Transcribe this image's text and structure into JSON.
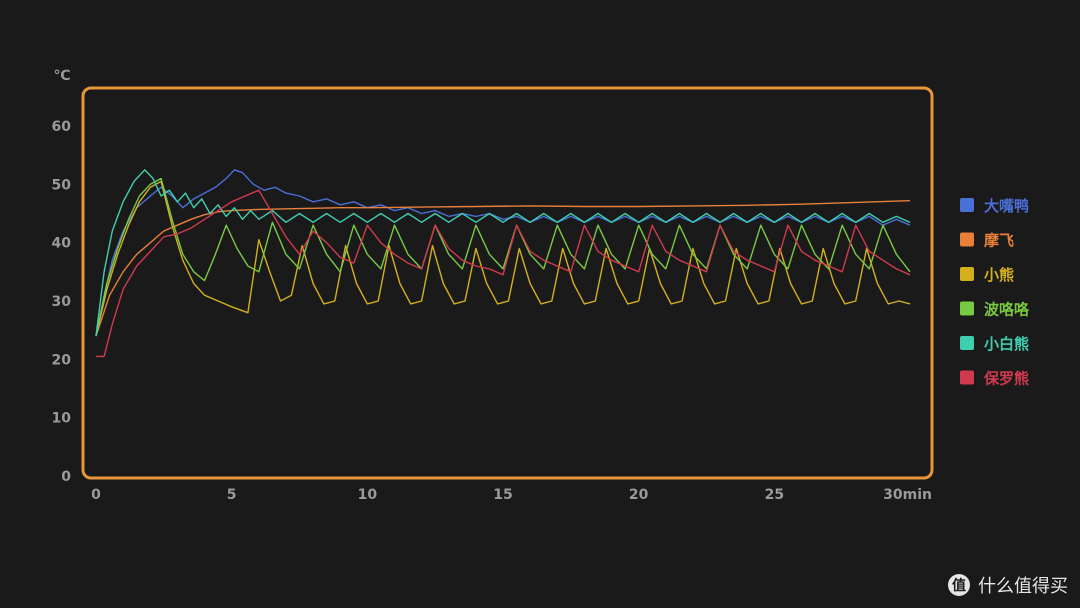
{
  "chart_data": {
    "type": "line",
    "ylabel": "℃",
    "xlim": [
      0,
      30
    ],
    "ylim": [
      0,
      60
    ],
    "x_ticks": [
      {
        "value": 0,
        "label": "0"
      },
      {
        "value": 5,
        "label": "5"
      },
      {
        "value": 10,
        "label": "10"
      },
      {
        "value": 15,
        "label": "15"
      },
      {
        "value": 20,
        "label": "20"
      },
      {
        "value": 25,
        "label": "25"
      },
      {
        "value": 30,
        "label": "30min"
      }
    ],
    "y_ticks": [
      0,
      10,
      20,
      30,
      40,
      50,
      60
    ],
    "grid": false,
    "legend_position": "right",
    "frame_color": "#e8963a",
    "series": [
      {
        "name": "大嘴鸭",
        "color": "#4a6fd6",
        "x": [
          0,
          0.3,
          0.6,
          1,
          1.5,
          2,
          2.4,
          2.8,
          3.2,
          3.6,
          4,
          4.4,
          4.8,
          5.1,
          5.4,
          5.8,
          6.2,
          6.6,
          7,
          7.5,
          8,
          8.5,
          9,
          9.5,
          10,
          10.5,
          11,
          11.5,
          12,
          12.5,
          13,
          13.5,
          14,
          14.5,
          15,
          15.5,
          16,
          16.5,
          17,
          17.5,
          18,
          18.5,
          19,
          19.5,
          20,
          20.5,
          21,
          21.5,
          22,
          22.5,
          23,
          23.5,
          24,
          24.5,
          25,
          25.5,
          26,
          26.5,
          27,
          27.5,
          28,
          28.5,
          29,
          29.5,
          30
        ],
        "values": [
          24,
          31,
          37,
          42,
          46,
          48,
          49.5,
          48,
          46,
          47.5,
          48.5,
          49.5,
          51,
          52.5,
          52,
          50,
          49,
          49.5,
          48.5,
          48,
          47,
          47.5,
          46.5,
          47,
          46,
          46.5,
          45.5,
          46,
          45,
          45.5,
          44.5,
          45,
          44.5,
          45,
          44,
          44.5,
          43.5,
          44.5,
          43.5,
          44.5,
          43.5,
          44.5,
          43.5,
          44.5,
          43.5,
          44.5,
          43.5,
          44.5,
          43.5,
          44.5,
          43.5,
          44.5,
          43.5,
          44.5,
          43.5,
          44.5,
          43.5,
          44.5,
          43.5,
          44.5,
          43.5,
          44.5,
          43,
          44,
          43
        ]
      },
      {
        "name": "摩飞",
        "color": "#e8803a",
        "x": [
          0,
          0.5,
          1,
          1.5,
          2,
          2.5,
          3,
          3.5,
          4,
          4.5,
          5,
          6,
          7,
          8,
          9,
          10,
          12,
          14,
          16,
          18,
          20,
          22,
          24,
          26,
          28,
          30
        ],
        "values": [
          24,
          31,
          35,
          38,
          40,
          42,
          43,
          44,
          44.8,
          45.3,
          45.5,
          45.7,
          45.8,
          45.9,
          46,
          46,
          46.1,
          46.2,
          46.3,
          46.2,
          46.2,
          46.3,
          46.4,
          46.6,
          46.9,
          47.2
        ]
      },
      {
        "name": "小熊",
        "color": "#d4b01e",
        "x": [
          0,
          0.4,
          0.8,
          1.2,
          1.6,
          2,
          2.4,
          2.8,
          3.2,
          3.6,
          4,
          4.5,
          5,
          5.6,
          6,
          6.4,
          6.8,
          7.2,
          7.6,
          8,
          8.4,
          8.8,
          9.2,
          9.6,
          10,
          10.4,
          10.8,
          11.2,
          11.6,
          12,
          12.4,
          12.8,
          13.2,
          13.6,
          14,
          14.4,
          14.8,
          15.2,
          15.6,
          16,
          16.4,
          16.8,
          17.2,
          17.6,
          18,
          18.4,
          18.8,
          19.2,
          19.6,
          20,
          20.4,
          20.8,
          21.2,
          21.6,
          22,
          22.4,
          22.8,
          23.2,
          23.6,
          24,
          24.4,
          24.8,
          25.2,
          25.6,
          26,
          26.4,
          26.8,
          27.2,
          27.6,
          28,
          28.4,
          28.8,
          29.2,
          29.6,
          30
        ],
        "values": [
          24,
          32,
          38,
          43,
          47,
          49.5,
          50.5,
          43,
          37,
          33,
          31,
          30,
          29,
          28,
          40.5,
          35,
          30,
          31,
          39.5,
          33,
          29.5,
          30,
          39.5,
          33,
          29.5,
          30,
          39.5,
          33,
          29.5,
          30,
          39.5,
          33,
          29.5,
          30,
          39,
          33,
          29.5,
          30,
          39,
          33,
          29.5,
          30,
          39,
          33,
          29.5,
          30,
          39,
          33,
          29.5,
          30,
          39,
          33,
          29.5,
          30,
          39,
          33,
          29.5,
          30,
          39,
          33,
          29.5,
          30,
          39,
          33,
          29.5,
          30,
          39,
          33,
          29.5,
          30,
          39,
          33,
          29.5,
          30,
          29.5
        ]
      },
      {
        "name": "波咯咯",
        "color": "#7ac943",
        "x": [
          0,
          0.4,
          0.8,
          1.2,
          1.6,
          2,
          2.4,
          2.8,
          3.2,
          3.6,
          4,
          4.4,
          4.8,
          5.2,
          5.6,
          6,
          6.5,
          7,
          7.5,
          8,
          8.5,
          9,
          9.5,
          10,
          10.5,
          11,
          11.5,
          12,
          12.5,
          13,
          13.5,
          14,
          14.5,
          15,
          15.5,
          16,
          16.5,
          17,
          17.5,
          18,
          18.5,
          19,
          19.5,
          20,
          20.5,
          21,
          21.5,
          22,
          22.5,
          23,
          23.5,
          24,
          24.5,
          25,
          25.5,
          26,
          26.5,
          27,
          27.5,
          28,
          28.5,
          29,
          29.5,
          30
        ],
        "values": [
          24,
          33,
          39,
          44,
          48,
          50,
          51,
          44,
          38,
          35,
          33.5,
          38,
          43,
          39,
          36,
          35,
          43.5,
          38,
          35.5,
          43,
          38,
          35,
          43,
          38,
          35.5,
          43,
          38,
          35.5,
          43,
          38,
          35.5,
          43,
          38,
          35.5,
          43,
          38,
          35.5,
          43,
          38,
          35.5,
          43,
          38,
          35.5,
          43,
          38,
          35.5,
          43,
          38,
          35.5,
          43,
          38,
          35.5,
          43,
          38,
          35.5,
          43,
          38,
          35.5,
          43,
          38,
          35.5,
          43,
          38,
          35
        ]
      },
      {
        "name": "小白熊",
        "color": "#3ecfb0",
        "x": [
          0,
          0.3,
          0.6,
          1,
          1.4,
          1.8,
          2.1,
          2.4,
          2.7,
          3,
          3.3,
          3.6,
          3.9,
          4.2,
          4.5,
          4.8,
          5.1,
          5.4,
          5.7,
          6,
          6.5,
          7,
          7.5,
          8,
          8.5,
          9,
          9.5,
          10,
          10.5,
          11,
          11.5,
          12,
          12.5,
          13,
          13.5,
          14,
          14.5,
          15,
          15.5,
          16,
          16.5,
          17,
          17.5,
          18,
          18.5,
          19,
          19.5,
          20,
          20.5,
          21,
          21.5,
          22,
          22.5,
          23,
          23.5,
          24,
          24.5,
          25,
          25.5,
          26,
          26.5,
          27,
          27.5,
          28,
          28.5,
          29,
          29.5,
          30
        ],
        "values": [
          24,
          35,
          42,
          47,
          50.5,
          52.5,
          51,
          48,
          49,
          47,
          48.5,
          46,
          47.5,
          45,
          46.5,
          44.5,
          46,
          44,
          45.5,
          44,
          45.5,
          43.5,
          45,
          43.5,
          45,
          43.5,
          45,
          43.5,
          45,
          43.5,
          45,
          43.5,
          45,
          43.5,
          45,
          43.5,
          45,
          43.5,
          45,
          43.5,
          45,
          43.5,
          45,
          43.5,
          45,
          43.5,
          45,
          43.5,
          45,
          43.5,
          45,
          43.5,
          45,
          43.5,
          45,
          43.5,
          45,
          43.5,
          45,
          43.5,
          45,
          43.5,
          45,
          43.5,
          45,
          43.5,
          44.5,
          43.5
        ]
      },
      {
        "name": "保罗熊",
        "color": "#d03a4e",
        "x": [
          0,
          0.3,
          0.6,
          1,
          1.5,
          2,
          2.5,
          3,
          3.5,
          4,
          4.5,
          5,
          5.5,
          6,
          6.5,
          7,
          7.5,
          8,
          8.5,
          9,
          9.5,
          10,
          10.5,
          11,
          11.5,
          12,
          12.5,
          13,
          13.5,
          14,
          14.5,
          15,
          15.5,
          16,
          16.5,
          17,
          17.5,
          18,
          18.5,
          19,
          19.5,
          20,
          20.5,
          21,
          21.5,
          22,
          22.5,
          23,
          23.5,
          24,
          24.5,
          25,
          25.5,
          26,
          26.5,
          27,
          27.5,
          28,
          28.5,
          29,
          29.5,
          30
        ],
        "values": [
          20.5,
          20.5,
          26,
          32,
          36,
          38.5,
          41,
          41.5,
          42.5,
          44,
          45.5,
          47,
          48,
          49,
          45,
          41,
          38,
          42,
          40,
          37.5,
          36.5,
          43,
          40,
          38,
          36.5,
          35.5,
          43,
          39,
          37,
          36,
          35.5,
          34.5,
          43,
          38.5,
          37,
          36,
          35,
          43,
          38.5,
          37,
          36,
          35,
          43,
          38.5,
          37,
          36,
          35,
          43,
          38.5,
          37,
          36,
          35,
          43,
          38.5,
          37,
          36,
          35,
          43,
          38.5,
          37,
          35.5,
          34.5
        ]
      }
    ]
  },
  "watermark": {
    "logo_glyph": "值",
    "text": "什么值得买"
  }
}
